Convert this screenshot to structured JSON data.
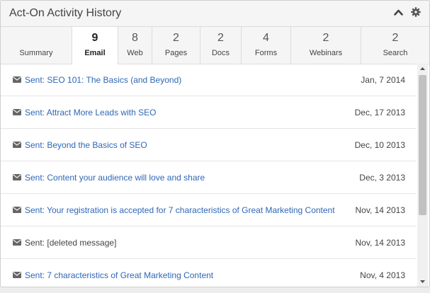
{
  "widget": {
    "title": "Act-On Activity History"
  },
  "tabs": [
    {
      "count": "",
      "label": "Summary"
    },
    {
      "count": "9",
      "label": "Email",
      "active": true
    },
    {
      "count": "8",
      "label": "Web"
    },
    {
      "count": "2",
      "label": "Pages"
    },
    {
      "count": "2",
      "label": "Docs"
    },
    {
      "count": "4",
      "label": "Forms"
    },
    {
      "count": "2",
      "label": "Webinars"
    },
    {
      "count": "2",
      "label": "Search"
    }
  ],
  "rows": [
    {
      "subject": "Sent: SEO 101: The Basics (and Beyond)",
      "date": "Jan, 7 2014",
      "link": true
    },
    {
      "subject": "Sent: Attract More Leads with SEO",
      "date": "Dec, 17 2013",
      "link": true
    },
    {
      "subject": "Sent: Beyond the Basics of SEO",
      "date": "Dec, 10 2013",
      "link": true
    },
    {
      "subject": "Sent: Content your audience will love and share",
      "date": "Dec, 3 2013",
      "link": true
    },
    {
      "subject": "Sent: Your registration is accepted for 7 characteristics of Great Marketing Content",
      "date": "Nov, 14 2013",
      "link": true
    },
    {
      "subject": "Sent: [deleted message]",
      "date": "Nov, 14 2013",
      "link": false
    },
    {
      "subject": "Sent: 7 characteristics of Great Marketing Content",
      "date": "Nov, 4 2013",
      "link": true
    }
  ],
  "colors": {
    "link": "#2f67b6",
    "header_bg": "#f5f5f5",
    "border": "#dcdcdc"
  },
  "icons": {
    "collapse": "chevron-up-icon",
    "settings": "gear-icon",
    "row": "envelope-icon"
  }
}
